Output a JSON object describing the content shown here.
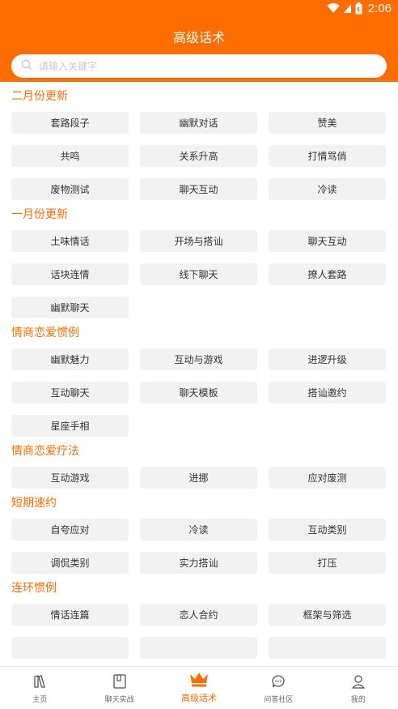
{
  "status_bar": {
    "time": "2:06"
  },
  "header": {
    "title": "高级话术"
  },
  "search": {
    "placeholder": "请输入关键字"
  },
  "sections": [
    {
      "title": "二月份更新",
      "items": [
        "套路段子",
        "幽默对话",
        "赞美",
        "共鸣",
        "关系升高",
        "打情骂俏",
        "废物测试",
        "聊天互动",
        "冷读"
      ]
    },
    {
      "title": "一月份更新",
      "items": [
        "土味情话",
        "开场与搭讪",
        "聊天互动",
        "话块连情",
        "线下聊天",
        "撩人套路",
        "幽默聊天"
      ]
    },
    {
      "title": "情商恋爱惯例",
      "items": [
        "幽默魅力",
        "互动与游戏",
        "进逻升级",
        "互动聊天",
        "聊天模板",
        "搭讪邀约",
        "星座手相"
      ]
    },
    {
      "title": "情商恋爱疗法",
      "items": [
        "互动游戏",
        "进挪",
        "应对废测"
      ]
    },
    {
      "title": "短期速约",
      "items": [
        "自夸应对",
        "冷读",
        "互动类别",
        "调侃类别",
        "实力搭讪",
        "打压"
      ]
    },
    {
      "title": "连环惯例",
      "items": [
        "情话连篇",
        "恋人合约",
        "框架与筛选",
        "",
        "",
        ""
      ]
    }
  ],
  "tabbar": {
    "items": [
      {
        "label": "主页",
        "icon": "home-icon",
        "active": false
      },
      {
        "label": "聊天实战",
        "icon": "chat-practice-icon",
        "active": false
      },
      {
        "label": "高级话术",
        "icon": "crown-icon",
        "active": true
      },
      {
        "label": "问答社区",
        "icon": "qa-bubble-icon",
        "active": false
      },
      {
        "label": "我的",
        "icon": "profile-icon",
        "active": false
      }
    ]
  },
  "colors": {
    "accent": "#ff6c00",
    "chip_bg": "#f2f2f2",
    "text": "#333333"
  }
}
